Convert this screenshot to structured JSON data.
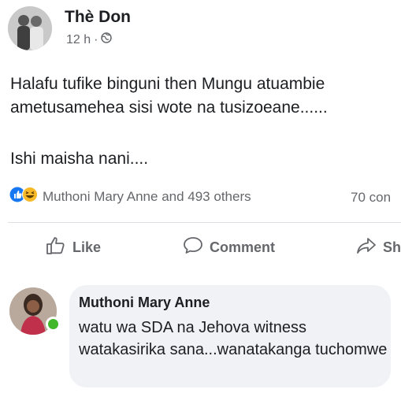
{
  "post": {
    "author": "Thè Don",
    "time": "12 h",
    "separator": "·",
    "privacy_icon": "globe-icon",
    "body_line_1": "Halafu tufike binguni then Mungu atuambie ametusamehea sisi wote na tusizoeane......",
    "body_line_2": "Ishi maisha nani...."
  },
  "reactions": {
    "icons": [
      "like-reaction-icon",
      "haha-reaction-icon"
    ],
    "text": "Muthoni Mary Anne and 493 others",
    "comments": "70 con"
  },
  "actions": {
    "like": "Like",
    "comment": "Comment",
    "share": "Sh"
  },
  "comment": {
    "author": "Muthoni Mary Anne",
    "text": "watu wa SDA na Jehova witness watakasirika sana...wanatakanga tuchomwe"
  },
  "colors": {
    "like_blue": "#1877f2",
    "haha_yellow": "#f7b928",
    "secondary_text": "#65676b",
    "bubble_bg": "#f0f2f5",
    "online_green": "#42b72a"
  }
}
